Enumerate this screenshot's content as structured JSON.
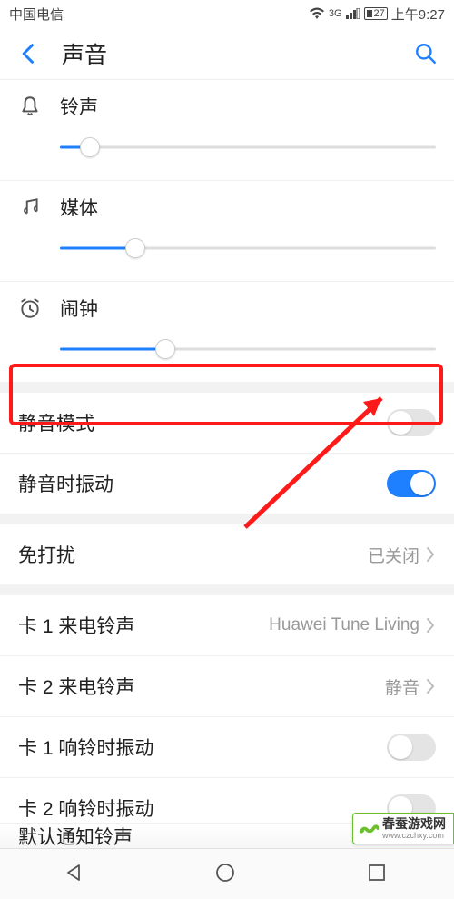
{
  "statusbar": {
    "carrier": "中国电信",
    "network": "3G",
    "battery": "27",
    "time": "上午9:27"
  },
  "header": {
    "title": "声音"
  },
  "sliders": {
    "ringtone": {
      "label": "铃声",
      "percent": 8
    },
    "media": {
      "label": "媒体",
      "percent": 20
    },
    "alarm": {
      "label": "闹钟",
      "percent": 28
    }
  },
  "toggles": {
    "silent": {
      "label": "静音模式",
      "on": false
    },
    "vibrate_silent": {
      "label": "静音时振动",
      "on": true
    },
    "sim1_vibrate": {
      "label": "卡 1 响铃时振动",
      "on": false
    },
    "sim2_vibrate": {
      "label": "卡 2 响铃时振动",
      "on": false
    }
  },
  "links": {
    "dnd": {
      "label": "免打扰",
      "value": "已关闭"
    },
    "sim1_ringtone": {
      "label": "卡 1 来电铃声",
      "value": "Huawei Tune Living"
    },
    "sim2_ringtone": {
      "label": "卡 2 来电铃声",
      "value": "静音"
    }
  },
  "default_notification": {
    "label": "默认通知铃声"
  },
  "watermark": {
    "name": "春蚕游戏网",
    "url": "www.czchxy.com"
  }
}
